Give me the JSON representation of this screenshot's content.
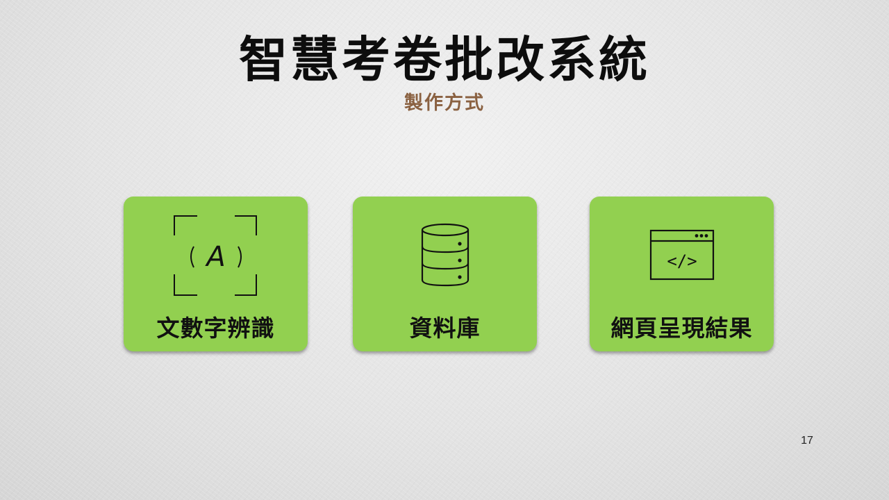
{
  "slide": {
    "title": "智慧考卷批改系統",
    "subtitle": "製作方式",
    "page_number": "17"
  },
  "cards": [
    {
      "label": "文數字辨識",
      "icon": "handwriting-recognition-icon",
      "icon_text": "A"
    },
    {
      "label": "資料庫",
      "icon": "database-icon"
    },
    {
      "label": "網頁呈現結果",
      "icon": "web-code-window-icon",
      "icon_text": "</>"
    }
  ],
  "colors": {
    "card_fill": "#92d050",
    "title": "#0d0d0d",
    "subtitle": "#8a6141"
  }
}
